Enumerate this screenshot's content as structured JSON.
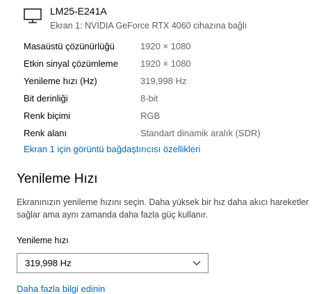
{
  "monitor": {
    "icon": "monitor-icon",
    "name": "LM25-E241A",
    "subtitle": "Ekran 1: NVIDIA GeForce RTX 4060 cihazına bağlı"
  },
  "properties": [
    {
      "label": "Masaüstü çözünürlüğü",
      "value": "1920 × 1080"
    },
    {
      "label": "Etkin sinyal çözümleme",
      "value": "1920 × 1080"
    },
    {
      "label": "Yenileme hızı (Hz)",
      "value": "319,998 Hz"
    },
    {
      "label": "Bit derinliği",
      "value": "8-bit"
    },
    {
      "label": "Renk biçimi",
      "value": "RGB"
    },
    {
      "label": "Renk alanı",
      "value": "Standart dinamik aralık (SDR)"
    }
  ],
  "adapter_link": "Ekran 1 için görüntü bağdaştırıcısı özellikleri",
  "refresh_section": {
    "title": "Yenileme Hızı",
    "description": "Ekranınızın yenileme hızını seçin. Daha yüksek bir hız daha akıcı hareketler sağlar ama aynı zamanda daha fazla güç kullanır.",
    "field_label": "Yenileme hızı",
    "selected_value": "319,998 Hz",
    "dropdown_icon": "chevron-down-icon",
    "more_info_link": "Daha fazla bilgi edinin"
  },
  "colors": {
    "link": "#0067b8",
    "secondary_text": "#666666",
    "border": "#8a8a8a"
  }
}
